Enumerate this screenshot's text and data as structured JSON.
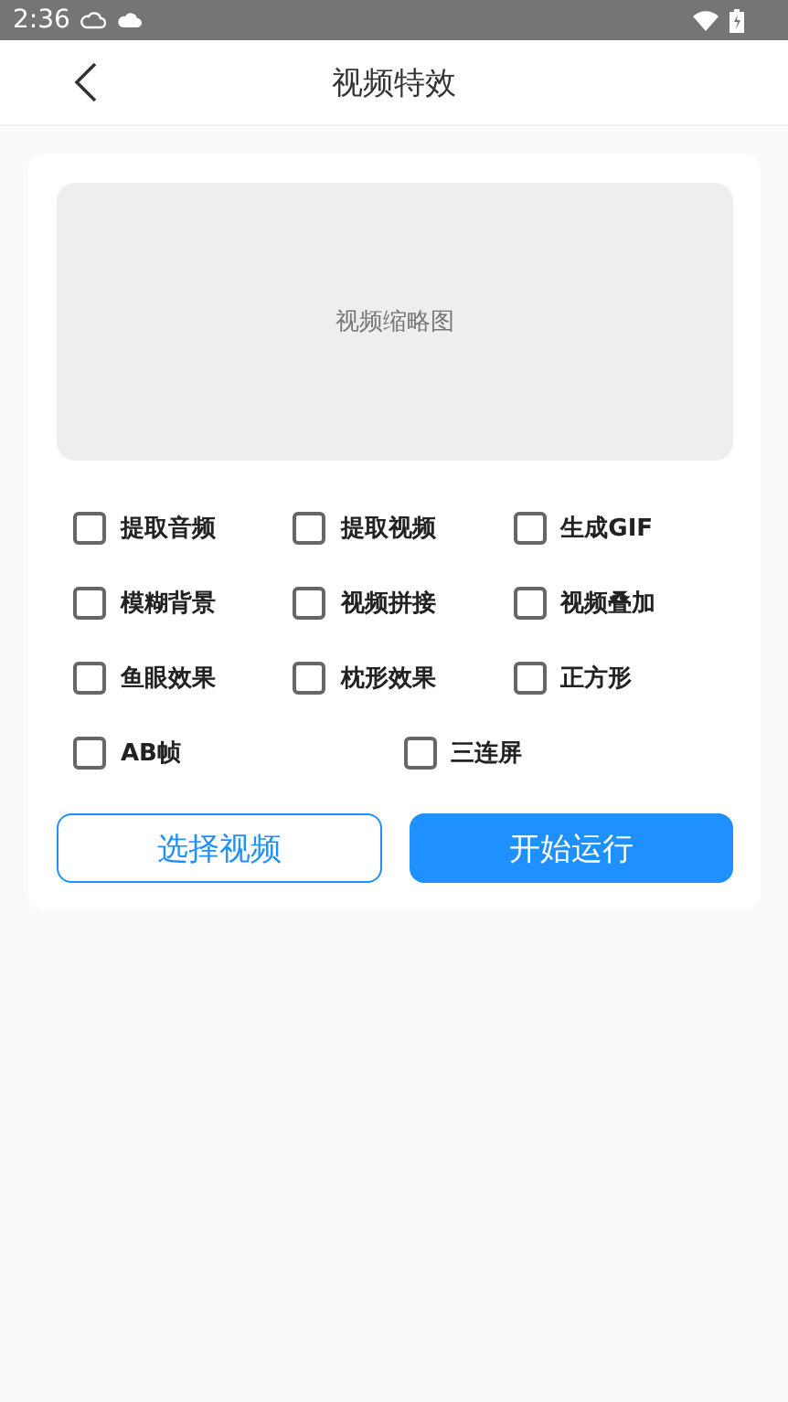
{
  "status_bar": {
    "time": "2:36"
  },
  "header": {
    "title": "视频特效"
  },
  "preview": {
    "label": "视频缩略图"
  },
  "option_rows": [
    [
      {
        "label": "提取音频",
        "checked": false
      },
      {
        "label": "提取视频",
        "checked": false
      },
      {
        "label": "生成GIF",
        "checked": false
      }
    ],
    [
      {
        "label": "模糊背景",
        "checked": false
      },
      {
        "label": "视频拼接",
        "checked": false
      },
      {
        "label": "视频叠加",
        "checked": false
      }
    ],
    [
      {
        "label": "鱼眼效果",
        "checked": false
      },
      {
        "label": "枕形效果",
        "checked": false
      },
      {
        "label": "正方形",
        "checked": false
      }
    ],
    [
      {
        "label": "AB帧",
        "checked": false
      },
      {
        "label": "三连屏",
        "checked": false
      }
    ]
  ],
  "buttons": [
    {
      "label": "选择视频",
      "kind": "outline"
    },
    {
      "label": "开始运行",
      "kind": "primary"
    }
  ]
}
